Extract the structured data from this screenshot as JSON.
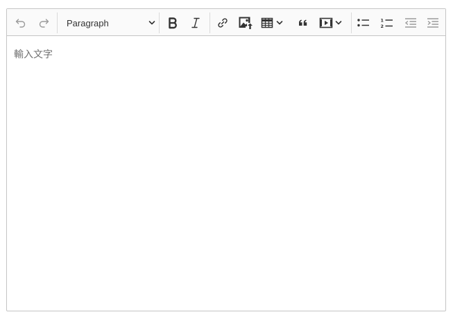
{
  "toolbar": {
    "heading": {
      "selected": "Paragraph"
    },
    "buttons": [
      {
        "name": "undo",
        "icon": "undo-icon",
        "enabled": false
      },
      {
        "name": "redo",
        "icon": "redo-icon",
        "enabled": false
      },
      {
        "name": "bold",
        "icon": "bold-icon"
      },
      {
        "name": "italic",
        "icon": "italic-icon"
      },
      {
        "name": "link",
        "icon": "link-icon"
      },
      {
        "name": "image-upload",
        "icon": "image-upload-icon"
      },
      {
        "name": "insert-table",
        "icon": "table-icon",
        "dropdown": true
      },
      {
        "name": "block-quote",
        "icon": "quote-icon"
      },
      {
        "name": "insert-media",
        "icon": "media-icon",
        "dropdown": true
      },
      {
        "name": "bulleted-list",
        "icon": "bulleted-list-icon"
      },
      {
        "name": "numbered-list",
        "icon": "numbered-list-icon"
      },
      {
        "name": "outdent",
        "icon": "outdent-icon",
        "enabled": false
      },
      {
        "name": "indent",
        "icon": "indent-icon",
        "enabled": false
      }
    ]
  },
  "content": {
    "placeholder": "輸入文字"
  },
  "colors": {
    "icon_active": "#333333",
    "icon_disabled": "#9a9a9a",
    "border": "#c4c4c4",
    "toolbar_bg": "#fafafa",
    "placeholder": "#707070"
  }
}
